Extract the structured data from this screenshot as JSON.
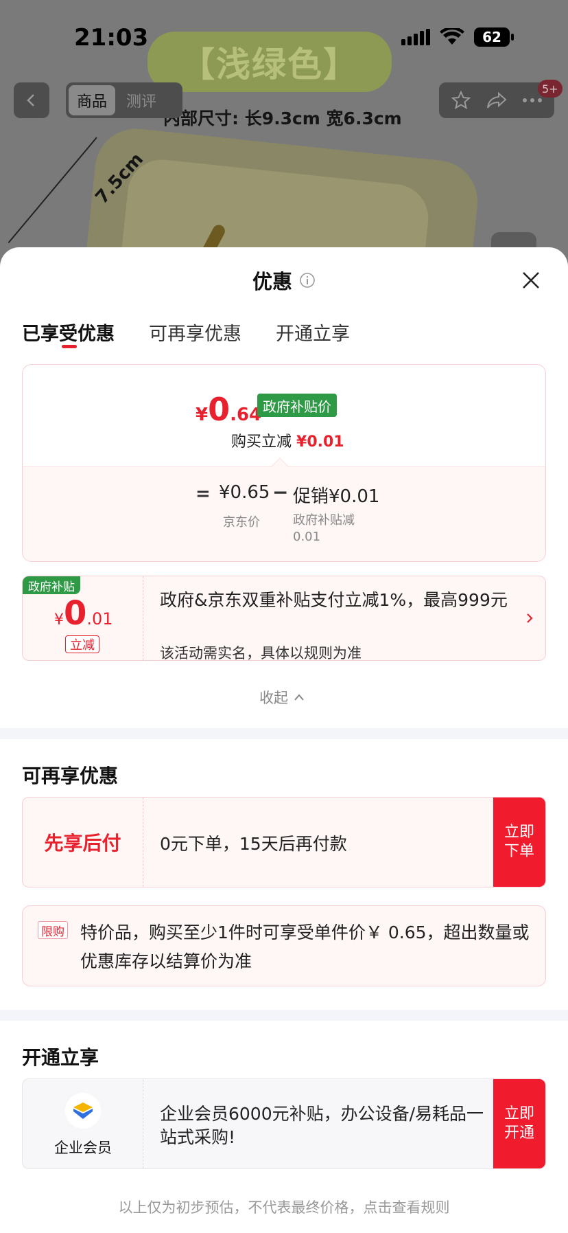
{
  "status_bar": {
    "time": "21:03",
    "battery": "62"
  },
  "background_page": {
    "banner": "【浅绿色】",
    "inner_size": "内部尺寸: 长9.3cm 宽6.3cm",
    "measure": "7.5cm"
  },
  "nav": {
    "tabs": [
      {
        "label": "商品"
      },
      {
        "label": "测评"
      }
    ],
    "badge": "5+",
    "icons": [
      "back-icon",
      "star-icon",
      "share-icon",
      "more-icon"
    ]
  },
  "sheet": {
    "title": "优惠",
    "tabs": [
      {
        "label": "已享受优惠"
      },
      {
        "label": "可再享优惠"
      },
      {
        "label": "开通立享"
      }
    ],
    "price_card": {
      "currency": "¥",
      "final_int": "0",
      "final_dec": ".64",
      "gov_tag": "政府补贴价",
      "reduce_label": "购买立减",
      "reduce_value": "¥0.01",
      "equals": "=",
      "jd_price": "¥0.65",
      "jd_label": "京东价",
      "minus": "−",
      "promo": "促销¥0.01",
      "promo_label": "政府补贴减0.01"
    },
    "gov_coupon": {
      "tag": "政府补贴",
      "currency": "¥",
      "amount_int": "0",
      "amount_dec": ".01",
      "button": "立减",
      "text": "政府&京东双重补贴支付立减1%，最高999元",
      "sub": "该活动需实名，具体以规则为准"
    },
    "collapse_label": "收起",
    "more_section": {
      "title": "可再享优惠",
      "pay_later": {
        "label": "先享后付",
        "text": "0元下单，15天后再付款",
        "button": "立即下单"
      },
      "limit": {
        "tag": "限购",
        "text": "特价品，购买至少1件时可享受单件价￥ 0.65，超出数量或优惠库存以结算价为准"
      }
    },
    "open_section": {
      "title": "开通立享",
      "enterprise": {
        "label": "企业会员",
        "text": "企业会员6000元补贴，办公设备/易耗品一站式采购!",
        "button": "立即开通"
      }
    },
    "footer_note": "以上仅为初步预估，不代表最终价格，点击查看规则"
  },
  "colors": {
    "accent_red": "#e8212e",
    "button_red": "#f01b2d",
    "gov_green": "#2e9a45"
  }
}
